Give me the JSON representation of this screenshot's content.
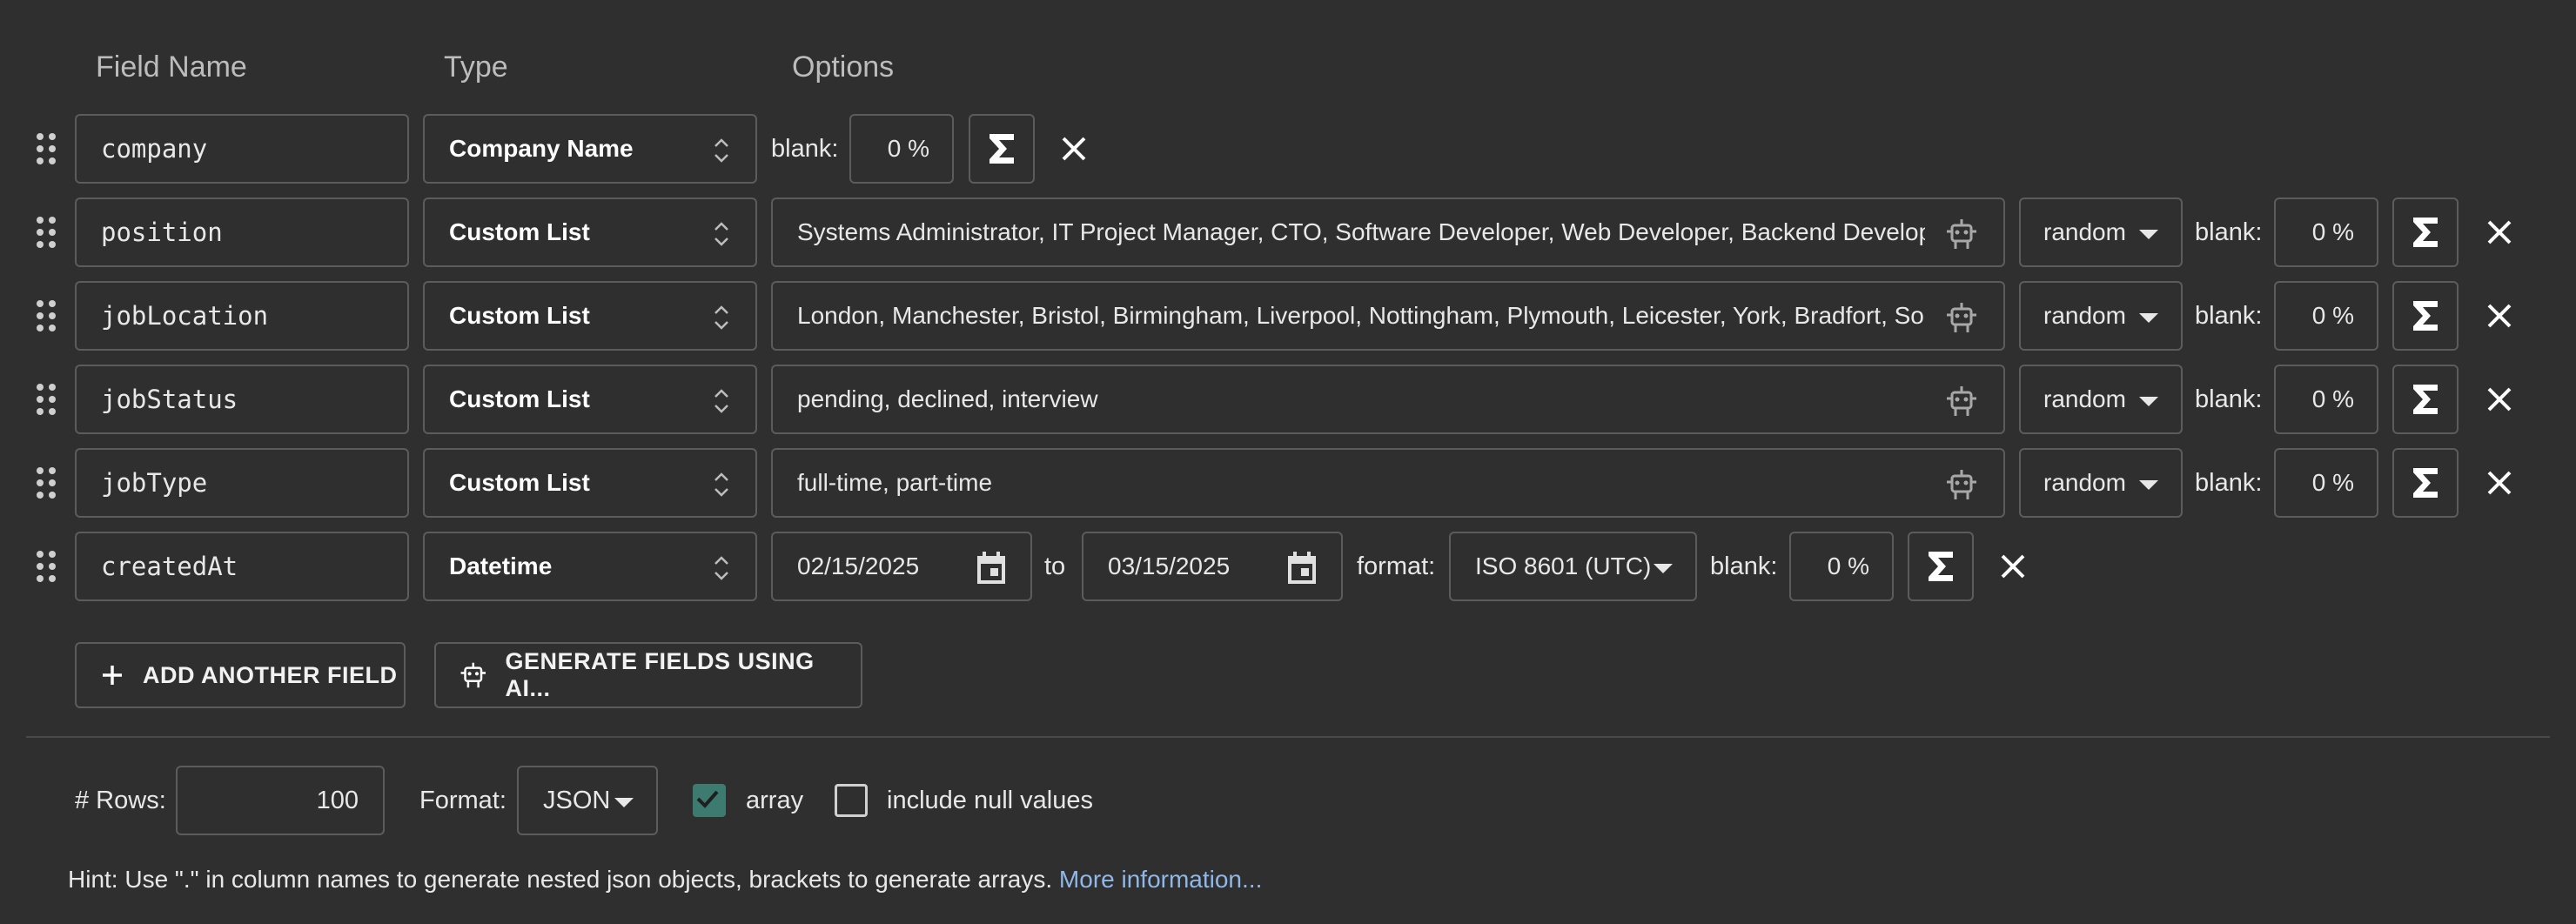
{
  "headers": {
    "field_name": "Field Name",
    "type": "Type",
    "options": "Options"
  },
  "labels": {
    "blank": "blank:",
    "to": "to",
    "format": "format:"
  },
  "rows": [
    {
      "name": "company",
      "type": "Company Name",
      "blank": "0 %"
    },
    {
      "name": "position",
      "type": "Custom List",
      "options": "Systems Administrator, IT Project Manager, CTO, Software Developer, Web Developer, Backend Developer, Frontend Developer",
      "order": "random",
      "blank": "0 %"
    },
    {
      "name": "jobLocation",
      "type": "Custom List",
      "options": "London, Manchester, Bristol, Birmingham, Liverpool, Nottingham, Plymouth, Leicester, York, Bradfort, Southampton",
      "order": "random",
      "blank": "0 %"
    },
    {
      "name": "jobStatus",
      "type": "Custom List",
      "options": "pending, declined, interview",
      "order": "random",
      "blank": "0 %"
    },
    {
      "name": "jobType",
      "type": "Custom List",
      "options": "full-time, part-time",
      "order": "random",
      "blank": "0 %"
    },
    {
      "name": "createdAt",
      "type": "Datetime",
      "from": "02/15/2025",
      "to": "03/15/2025",
      "format": "ISO 8601 (UTC)",
      "blank": "0 %"
    }
  ],
  "actions": {
    "add_field": "ADD ANOTHER FIELD",
    "generate_ai": "GENERATE FIELDS USING AI..."
  },
  "footer": {
    "rows_label": "# Rows:",
    "rows_value": "100",
    "format_label": "Format:",
    "format_value": "JSON",
    "array_label": "array",
    "array_checked": true,
    "null_label": "include null values",
    "null_checked": false
  },
  "hint": {
    "text": "Hint: Use \".\" in column names to generate nested json objects, brackets to generate arrays.",
    "link": "More information..."
  },
  "colors": {
    "background": "#2f2f2f",
    "border": "#5c5c5c",
    "checkbox": "#3d7a6f",
    "link": "#8fb8e8"
  },
  "icons": [
    "drag-handle-icon",
    "up-down-arrows-icon",
    "sigma-icon",
    "close-icon",
    "robot-icon",
    "calendar-icon",
    "plus-icon",
    "caret-down-icon",
    "check-icon"
  ]
}
